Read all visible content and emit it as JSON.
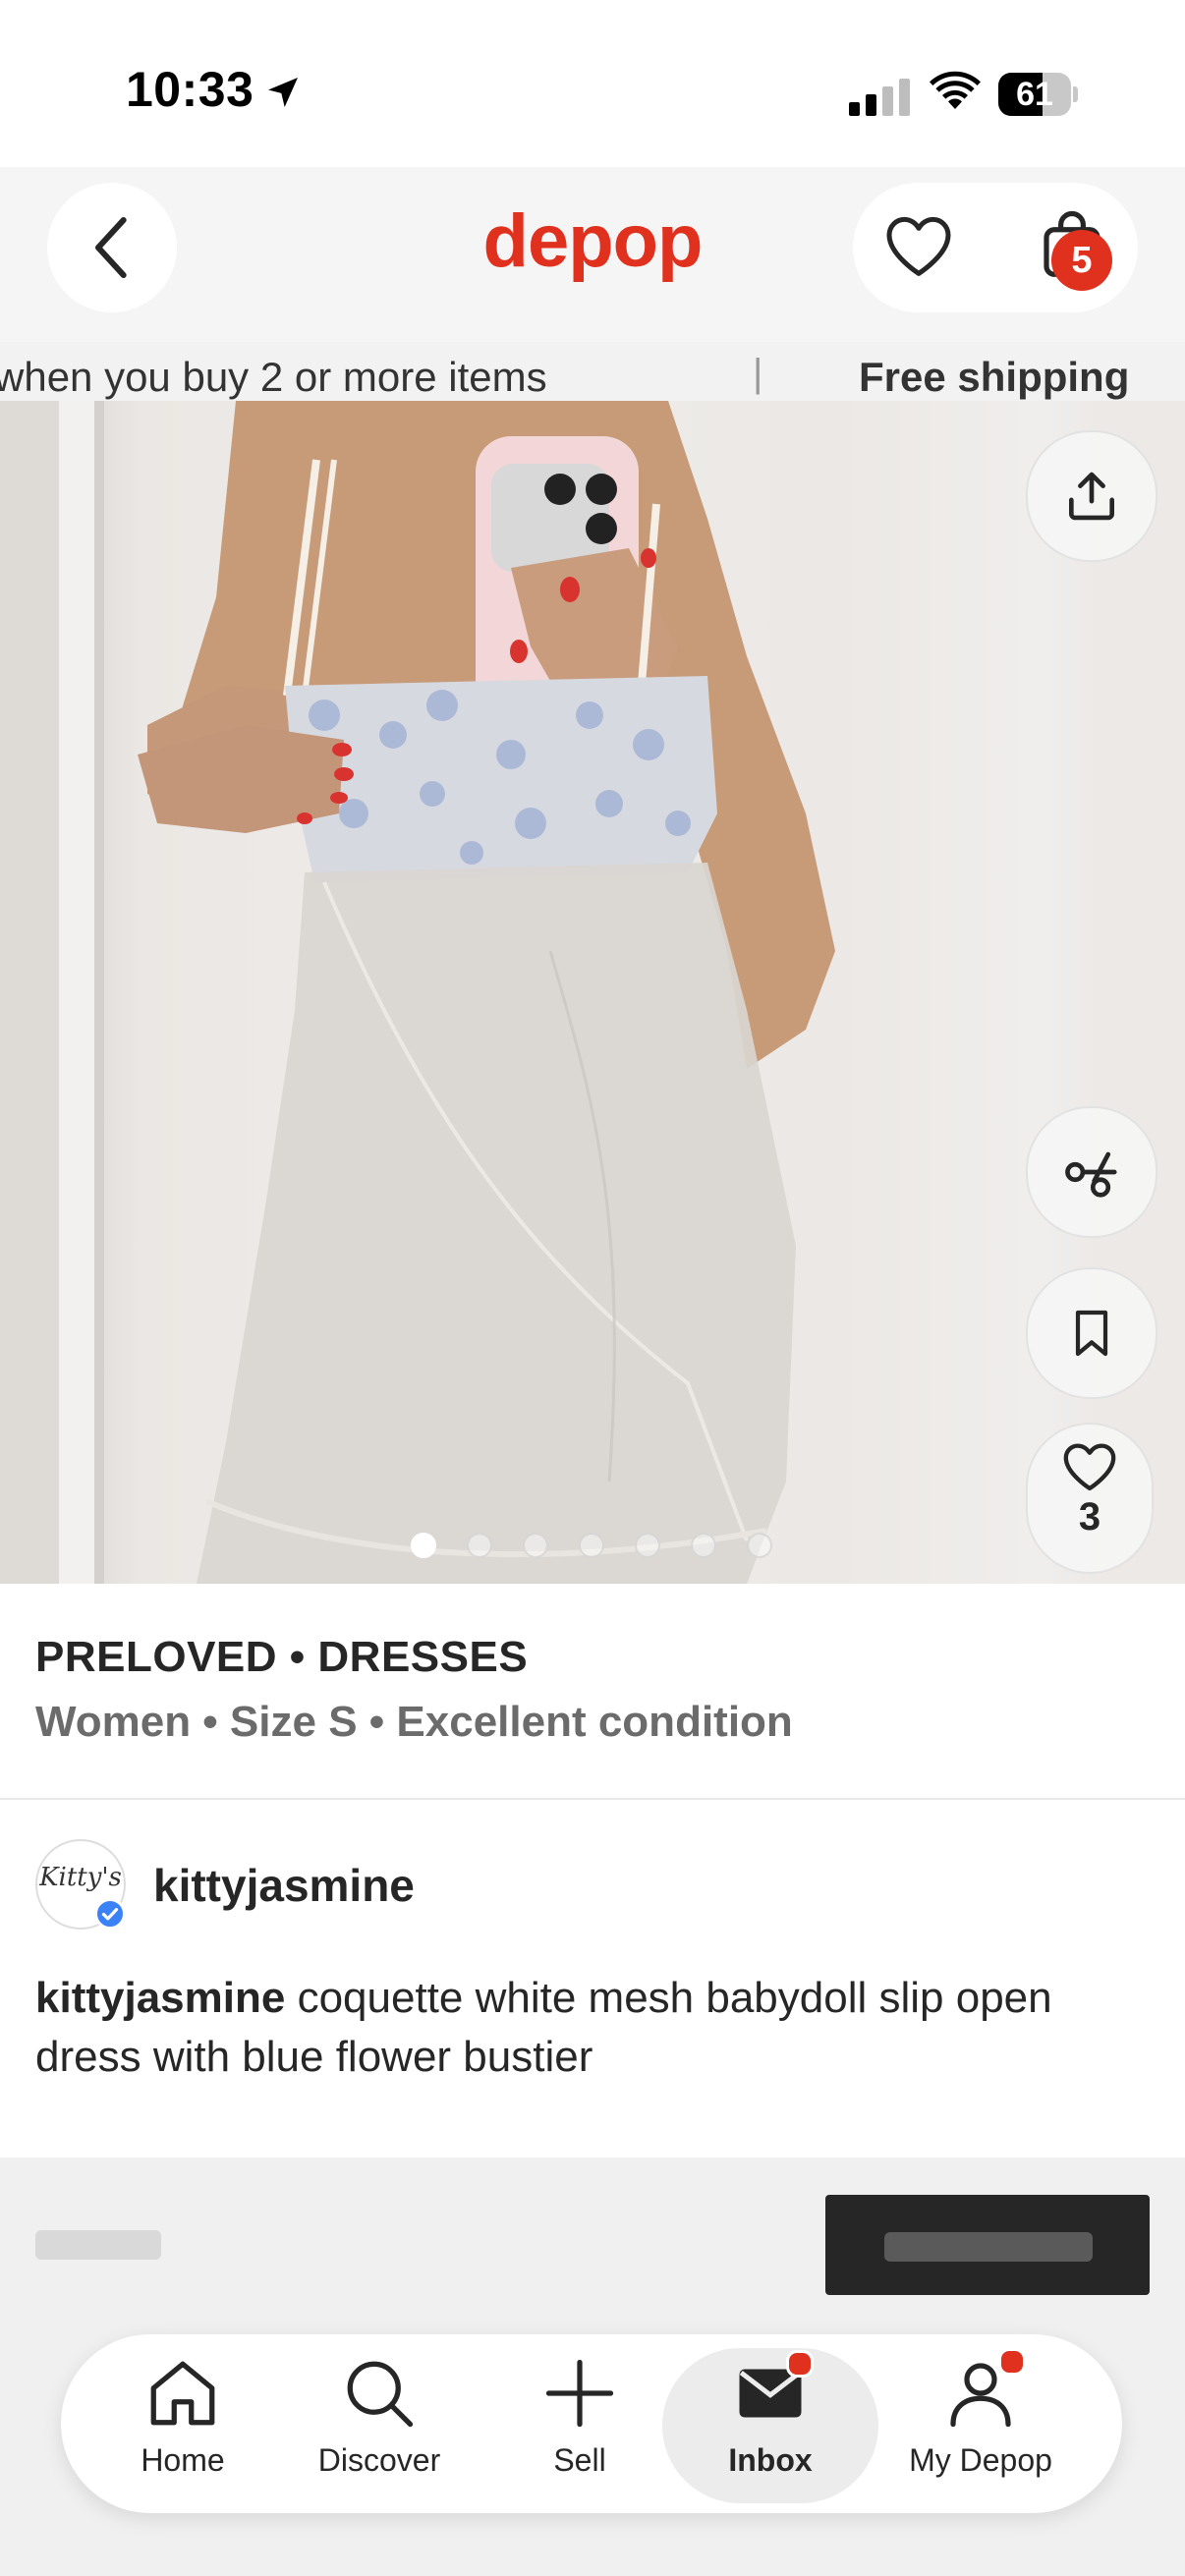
{
  "status_bar": {
    "time": "10:33",
    "battery": "61",
    "battery_level": 0.61
  },
  "header": {
    "logo": "depop",
    "bag_badge": "5"
  },
  "promo": {
    "text": "when you buy 2 or more items",
    "separator": "|",
    "highlight": "Free shipping"
  },
  "photo": {
    "total_images": 7,
    "active_index": 0
  },
  "actions": {
    "like_count": "3"
  },
  "product": {
    "category": "PRELOVED • DRESSES",
    "attributes": "Women • Size S • Excellent condition",
    "seller": "kittyjasmine",
    "avatar_text": "Kitty's",
    "description_user": "kittyjasmine",
    "description_text": " coquette white mesh babydoll slip open dress with blue flower bustier"
  },
  "tabs": [
    {
      "label": "Home",
      "icon": "home-icon"
    },
    {
      "label": "Discover",
      "icon": "search-icon"
    },
    {
      "label": "Sell",
      "icon": "plus-icon"
    },
    {
      "label": "Inbox",
      "icon": "mail-icon"
    },
    {
      "label": "My Depop",
      "icon": "profile-icon"
    }
  ],
  "colors": {
    "brand": "#e0301e",
    "text": "#262626",
    "secondary_text": "#6b6b6b"
  }
}
